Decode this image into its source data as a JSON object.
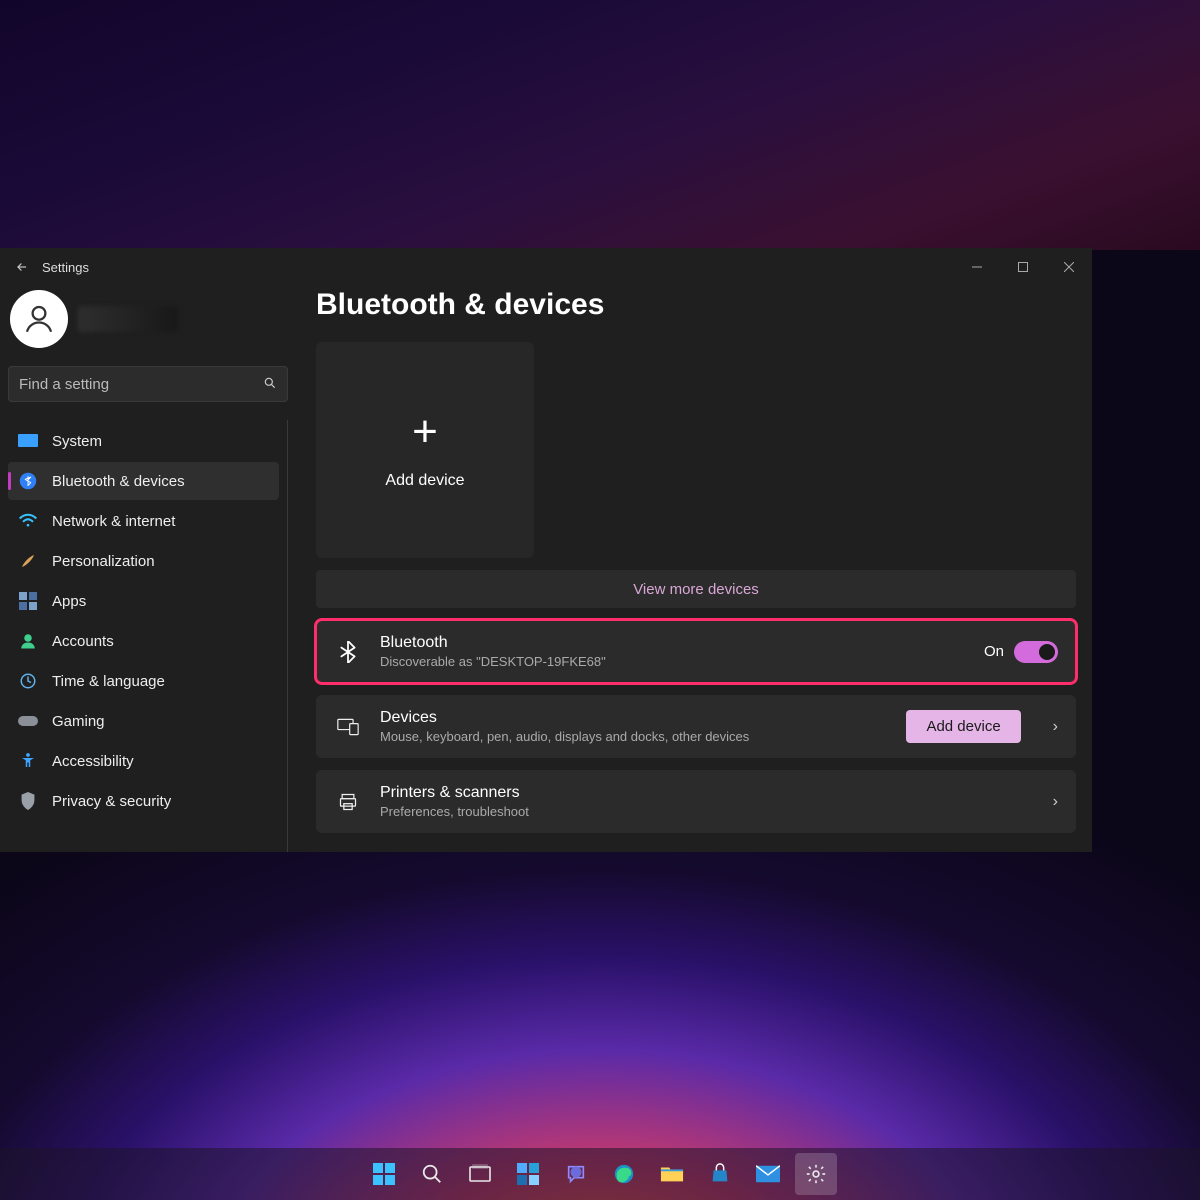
{
  "window": {
    "title": "Settings"
  },
  "search": {
    "placeholder": "Find a setting"
  },
  "sidebar": {
    "items": [
      {
        "label": "System"
      },
      {
        "label": "Bluetooth & devices"
      },
      {
        "label": "Network & internet"
      },
      {
        "label": "Personalization"
      },
      {
        "label": "Apps"
      },
      {
        "label": "Accounts"
      },
      {
        "label": "Time & language"
      },
      {
        "label": "Gaming"
      },
      {
        "label": "Accessibility"
      },
      {
        "label": "Privacy & security"
      }
    ],
    "active_index": 1
  },
  "page": {
    "title": "Bluetooth & devices",
    "add_device_tile": "Add device",
    "view_more": "View more devices",
    "bluetooth_row": {
      "title": "Bluetooth",
      "subtitle": "Discoverable as \"DESKTOP-19FKE68\"",
      "state_label": "On",
      "state_on": true
    },
    "devices_row": {
      "title": "Devices",
      "subtitle": "Mouse, keyboard, pen, audio, displays and docks, other devices",
      "button": "Add device"
    },
    "printers_row": {
      "title": "Printers & scanners",
      "subtitle": "Preferences, troubleshoot"
    }
  },
  "taskbar": {
    "items": [
      "start",
      "search",
      "task-view",
      "widgets",
      "chat",
      "edge",
      "file-explorer",
      "store",
      "mail",
      "settings"
    ],
    "active": "settings"
  },
  "colors": {
    "accent": "#d36bdc",
    "highlight": "#ff2d6b"
  }
}
